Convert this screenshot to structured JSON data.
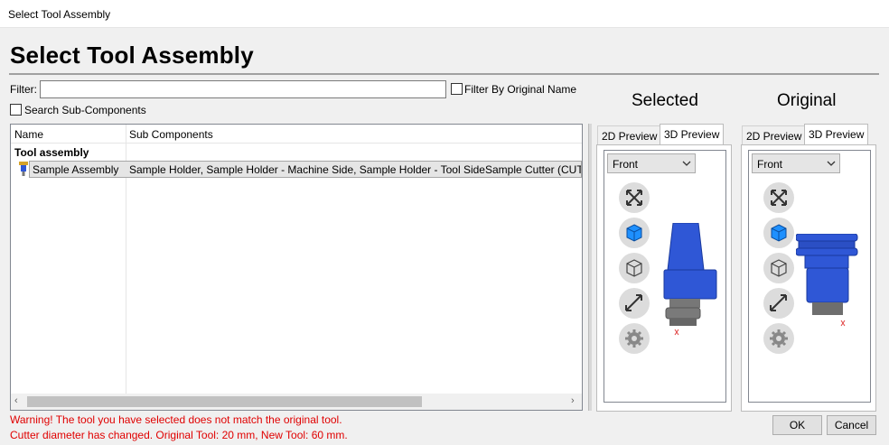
{
  "window": {
    "title": "Select Tool Assembly"
  },
  "heading": "Select Tool Assembly",
  "filter": {
    "label": "Filter:",
    "value": "",
    "by_original_name_label": "Filter By Original Name",
    "by_original_name_checked": false
  },
  "search_sub_components": {
    "label": "Search Sub-Components",
    "checked": false
  },
  "grid": {
    "columns": [
      "Name",
      "Sub Components"
    ],
    "group": "Tool assembly",
    "rows": [
      {
        "name": "Sample Assembly",
        "sub_components": "Sample Holder, Sample Holder - Machine Side, Sample Holder - Tool SideSample Cutter (CUTTING"
      }
    ]
  },
  "selected_panel": {
    "title": "Selected",
    "tabs": [
      "2D Preview",
      "3D Preview"
    ],
    "active_tab": "3D Preview",
    "view": "Front"
  },
  "original_panel": {
    "title": "Original",
    "tabs": [
      "2D Preview",
      "3D Preview"
    ],
    "active_tab": "3D Preview",
    "view": "Front"
  },
  "view_buttons": [
    "zoom-extents-icon",
    "shaded-cube-icon",
    "wireframe-cube-icon",
    "measure-icon",
    "settings-gear-icon"
  ],
  "warnings": {
    "line1": "Warning! The tool you have selected does not match the original tool.",
    "line2": "Cutter diameter has changed. Original Tool: 20 mm, New Tool: 60 mm."
  },
  "buttons": {
    "ok": "OK",
    "cancel": "Cancel"
  },
  "colors": {
    "warning": "#e00000",
    "tool_blue": "#2f57d6",
    "selection": "#e5e5e5"
  }
}
